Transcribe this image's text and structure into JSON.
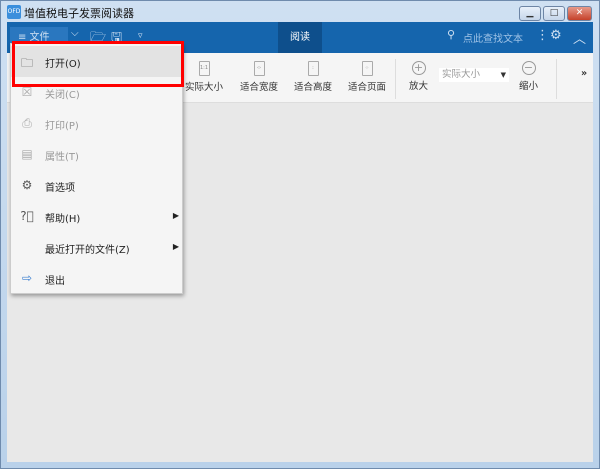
{
  "window": {
    "title": "增值税电子发票阅读器",
    "icon_text": "OFD",
    "minimize": "▁",
    "maximize": "□",
    "close": "✕"
  },
  "ribbon": {
    "file_label": "≡ 文件",
    "tab_read": "阅读",
    "search_placeholder": "点此查找文本"
  },
  "toolbar": {
    "actual_size": "实际大小",
    "fit_width": "适合宽度",
    "fit_height": "适合高度",
    "fit_page": "适合页面",
    "zoom_in": "放大",
    "zoom_value": "实际大小",
    "zoom_out": "缩小",
    "more": "»"
  },
  "menu": {
    "items": [
      {
        "label": "打开(O)",
        "icon": "folder-icon",
        "enabled": true
      },
      {
        "label": "关闭(C)",
        "icon": "close-doc-icon",
        "enabled": false
      },
      {
        "label": "打印(P)",
        "icon": "printer-icon",
        "enabled": false
      },
      {
        "label": "属性(T)",
        "icon": "properties-icon",
        "enabled": false
      },
      {
        "label": "首选项",
        "icon": "gear-icon",
        "enabled": true
      },
      {
        "label": "帮助(H)",
        "icon": "help-icon",
        "enabled": true,
        "submenu": true
      },
      {
        "label": "最近打开的文件(Z)",
        "icon": "",
        "enabled": true,
        "submenu": true
      },
      {
        "label": "退出",
        "icon": "exit-icon",
        "enabled": true
      }
    ]
  }
}
